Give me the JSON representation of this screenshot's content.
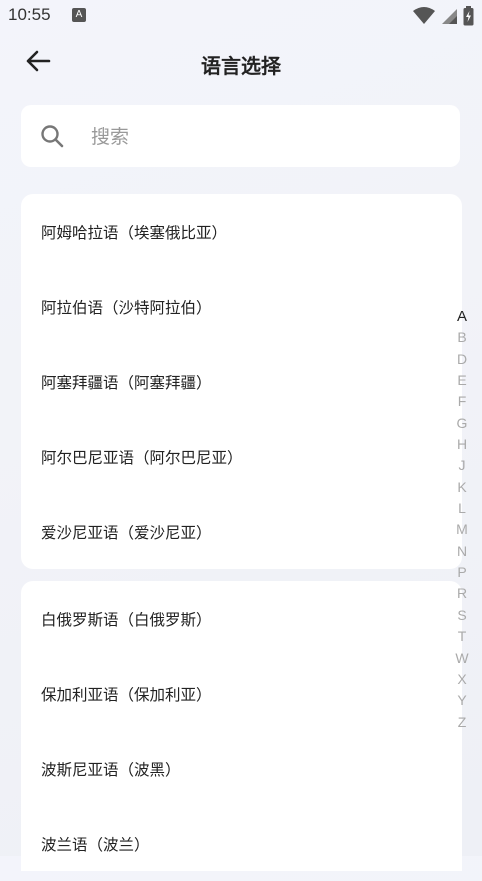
{
  "status_bar": {
    "time": "10:55",
    "notification_glyph": "A",
    "icons": [
      "wifi-icon",
      "signal-icon",
      "battery-icon"
    ]
  },
  "header": {
    "title": "语言选择",
    "back_icon": "arrow-left-icon"
  },
  "search": {
    "placeholder": "搜索",
    "value": ""
  },
  "groups": [
    {
      "items": [
        {
          "label": "阿姆哈拉语（埃塞俄比亚）"
        },
        {
          "label": "阿拉伯语（沙特阿拉伯）"
        },
        {
          "label": "阿塞拜疆语（阿塞拜疆）"
        },
        {
          "label": "阿尔巴尼亚语（阿尔巴尼亚）"
        },
        {
          "label": "爱沙尼亚语（爱沙尼亚）"
        }
      ]
    },
    {
      "items": [
        {
          "label": "白俄罗斯语（白俄罗斯）"
        },
        {
          "label": "保加利亚语（保加利亚）"
        },
        {
          "label": "波斯尼亚语（波黑）"
        },
        {
          "label": "波兰语（波兰）"
        }
      ]
    }
  ],
  "alphabet_index": {
    "letters": [
      "A",
      "B",
      "D",
      "E",
      "F",
      "G",
      "H",
      "J",
      "K",
      "L",
      "M",
      "N",
      "P",
      "R",
      "S",
      "T",
      "W",
      "X",
      "Y",
      "Z"
    ],
    "active": "A"
  },
  "colors": {
    "background": "#f2f3f8",
    "card": "#ffffff",
    "text": "#222222",
    "index_inactive": "#aaaaaa"
  }
}
